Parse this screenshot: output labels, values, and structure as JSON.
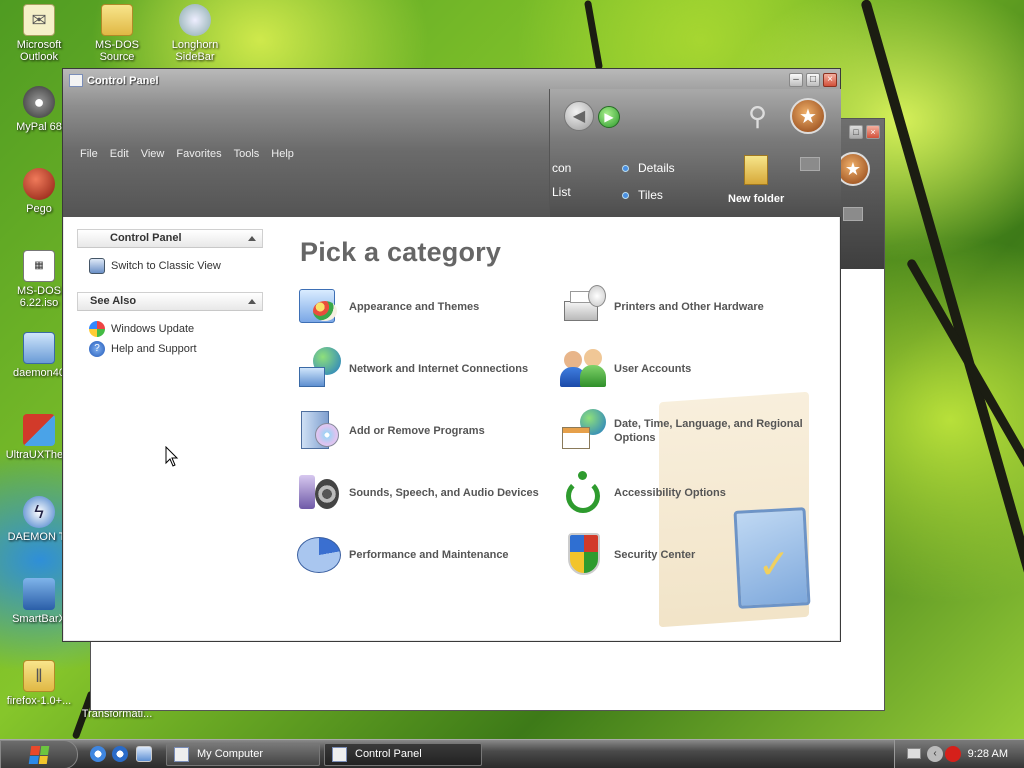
{
  "desktop": {
    "icons": [
      {
        "label": "Microsoft Outlook",
        "icon": "outlook-icon"
      },
      {
        "label": "MS-DOS Source",
        "icon": "folder-icon"
      },
      {
        "label": "Longhorn SideBar",
        "icon": "sidebar-icon"
      },
      {
        "label": "MyPal 68",
        "icon": "raccoon-icon"
      },
      {
        "label": "Pego",
        "icon": "pego-icon"
      },
      {
        "label": "MS-DOS 6.22.iso",
        "icon": "iso-icon"
      },
      {
        "label": "daemon40",
        "icon": "daemon-installer-icon"
      },
      {
        "label": "UltraUXThem",
        "icon": "theme-patcher-icon"
      },
      {
        "label": "DAEMON To",
        "icon": "daemon-tools-icon"
      },
      {
        "label": "SmartBarX",
        "icon": "smartbar-icon"
      },
      {
        "label": "firefox-1.0+...",
        "icon": "zip-icon"
      },
      {
        "label": "Transformati...",
        "icon": "transformation-icon"
      }
    ]
  },
  "window": {
    "title": "Control Panel",
    "menu": [
      "File",
      "Edit",
      "View",
      "Favorites",
      "Tools",
      "Help"
    ],
    "toolbar": {
      "views": [
        "con",
        "List",
        "Details",
        "Tiles"
      ],
      "new_folder": "New folder"
    },
    "sidebar": {
      "sections": [
        {
          "title": "Control Panel",
          "items": [
            {
              "label": "Switch to Classic View",
              "icon": "classic-view-icon"
            }
          ]
        },
        {
          "title": "See Also",
          "items": [
            {
              "label": "Windows Update",
              "icon": "windows-update-icon"
            },
            {
              "label": "Help and Support",
              "icon": "help-icon"
            }
          ]
        }
      ]
    },
    "main": {
      "heading": "Pick a category",
      "categories": [
        {
          "label": "Appearance and Themes",
          "icon": "appearance-themes-icon"
        },
        {
          "label": "Printers and Other Hardware",
          "icon": "printer-icon"
        },
        {
          "label": "Network and Internet Connections",
          "icon": "network-icon"
        },
        {
          "label": "User Accounts",
          "icon": "user-accounts-icon"
        },
        {
          "label": "Add or Remove Programs",
          "icon": "add-remove-programs-icon"
        },
        {
          "label": "Date, Time, Language, and Regional Options",
          "icon": "date-time-icon"
        },
        {
          "label": "Sounds, Speech, and Audio Devices",
          "icon": "sound-icon"
        },
        {
          "label": "Accessibility Options",
          "icon": "accessibility-icon"
        },
        {
          "label": "Performance and Maintenance",
          "icon": "performance-icon"
        },
        {
          "label": "Security Center",
          "icon": "security-shield-icon"
        }
      ]
    }
  },
  "taskbar": {
    "tasks": [
      "My Computer",
      "Control Panel"
    ],
    "clock": "9:28 AM"
  }
}
